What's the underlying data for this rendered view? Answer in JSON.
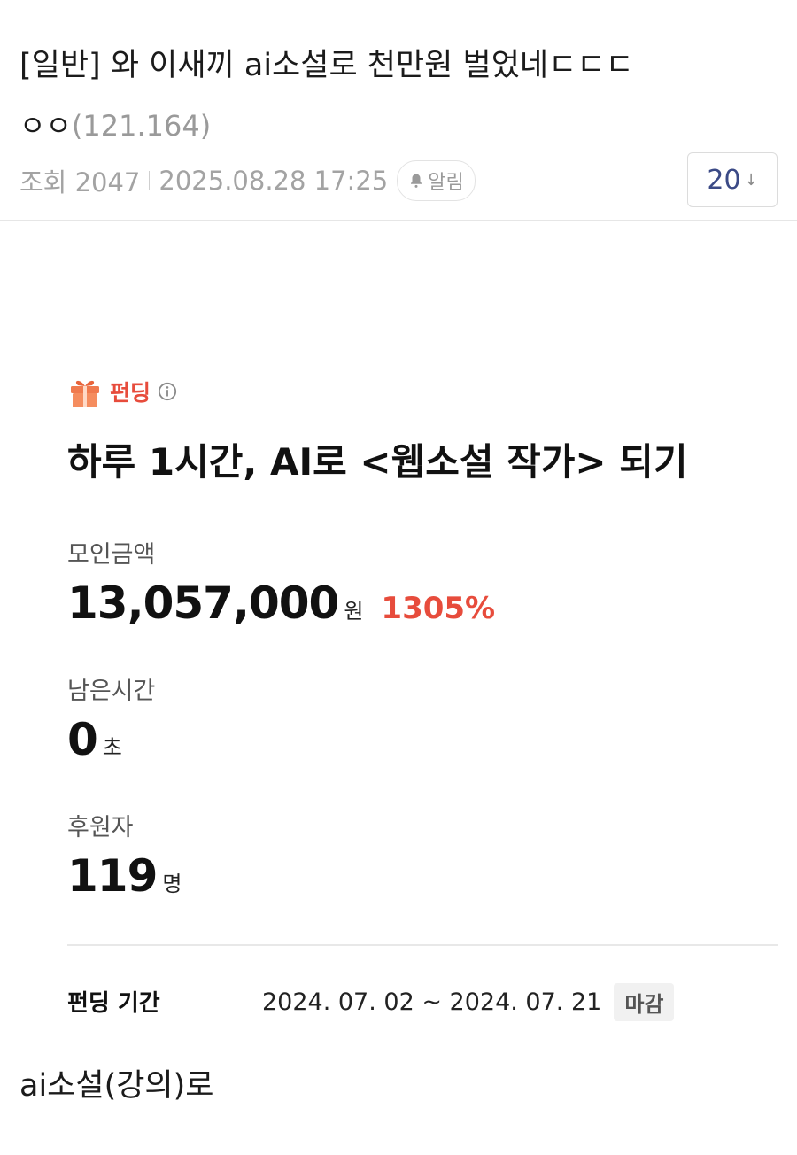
{
  "post": {
    "title": "[일반] 와 이새끼 ai소설로 천만원 벌었네ㄷㄷㄷ",
    "author_name": "ㅇㅇ",
    "author_ip": "(121.164)",
    "views_text": "조회 2047",
    "datetime": "2025.08.28 17:25",
    "alarm_label": "알림",
    "comment_count": "20",
    "body_text": "ai소설(강의)로"
  },
  "funding": {
    "badge_label": "펀딩",
    "title": "하루 1시간, AI로 <웹소설 작가> 되기",
    "amount_label": "모인금액",
    "amount_value": "13,057,000",
    "amount_unit": "원",
    "percent": "1305%",
    "time_label": "남은시간",
    "time_value": "0",
    "time_unit": "초",
    "backers_label": "후원자",
    "backers_value": "119",
    "backers_unit": "명",
    "period_label": "펀딩 기간",
    "period_value": "2024. 07. 02 ~ 2024. 07. 21",
    "status_badge": "마감"
  },
  "colors": {
    "accent_red": "#e74c3c",
    "comment_blue": "#3b4a86",
    "muted_gray": "#a3a3a3"
  },
  "icons": [
    "bell-icon",
    "gift-icon",
    "info-icon",
    "arrow-down-icon"
  ]
}
